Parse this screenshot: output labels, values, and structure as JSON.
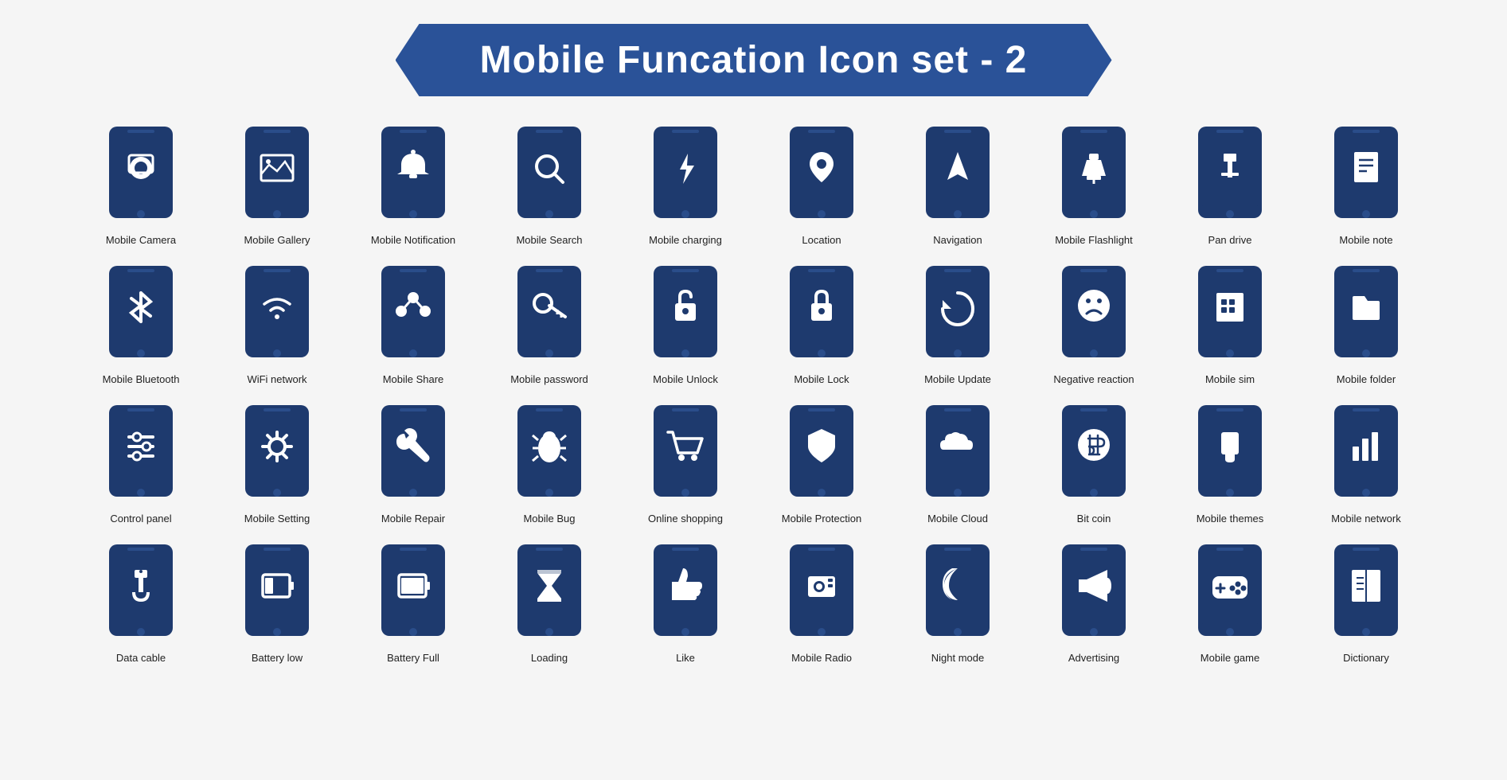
{
  "header": {
    "title": "Mobile Funcation Icon set - 2"
  },
  "icons": [
    {
      "id": "mobile-camera",
      "label": "Mobile Camera",
      "symbol": "camera"
    },
    {
      "id": "mobile-gallery",
      "label": "Mobile Gallery",
      "symbol": "gallery"
    },
    {
      "id": "mobile-notification",
      "label": "Mobile Notification",
      "symbol": "bell"
    },
    {
      "id": "mobile-search",
      "label": "Mobile Search",
      "symbol": "search"
    },
    {
      "id": "mobile-charging",
      "label": "Mobile charging",
      "symbol": "charging"
    },
    {
      "id": "location",
      "label": "Location",
      "symbol": "location"
    },
    {
      "id": "navigation",
      "label": "Navigation",
      "symbol": "navigation"
    },
    {
      "id": "mobile-flashlight",
      "label": "Mobile Flashlight",
      "symbol": "flashlight"
    },
    {
      "id": "pan-drive",
      "label": "Pan drive",
      "symbol": "usb"
    },
    {
      "id": "mobile-note",
      "label": "Mobile note",
      "symbol": "note"
    },
    {
      "id": "mobile-bluetooth",
      "label": "Mobile Bluetooth",
      "symbol": "bluetooth"
    },
    {
      "id": "wifi-network",
      "label": "WiFi network",
      "symbol": "wifi"
    },
    {
      "id": "mobile-share",
      "label": "Mobile Share",
      "symbol": "share"
    },
    {
      "id": "mobile-password",
      "label": "Mobile password",
      "symbol": "key"
    },
    {
      "id": "mobile-unlock",
      "label": "Mobile Unlock",
      "symbol": "unlock"
    },
    {
      "id": "mobile-lock",
      "label": "Mobile Lock",
      "symbol": "lock"
    },
    {
      "id": "mobile-update",
      "label": "Mobile Update",
      "symbol": "update"
    },
    {
      "id": "negative-reaction",
      "label": "Negative reaction",
      "symbol": "sad"
    },
    {
      "id": "mobile-sim",
      "label": "Mobile sim",
      "symbol": "sim"
    },
    {
      "id": "mobile-folder",
      "label": "Mobile folder",
      "symbol": "folder"
    },
    {
      "id": "control-panel",
      "label": "Control panel",
      "symbol": "sliders"
    },
    {
      "id": "mobile-setting",
      "label": "Mobile Setting",
      "symbol": "gear"
    },
    {
      "id": "mobile-repair",
      "label": "Mobile Repair",
      "symbol": "wrench"
    },
    {
      "id": "mobile-bug",
      "label": "Mobile Bug",
      "symbol": "bug"
    },
    {
      "id": "online-shopping",
      "label": "Online shopping",
      "symbol": "cart"
    },
    {
      "id": "mobile-protection",
      "label": "Mobile Protection",
      "symbol": "shield"
    },
    {
      "id": "mobile-cloud",
      "label": "Mobile Cloud",
      "symbol": "cloud"
    },
    {
      "id": "bit-coin",
      "label": "Bit coin",
      "symbol": "bitcoin"
    },
    {
      "id": "mobile-themes",
      "label": "Mobile themes",
      "symbol": "brush"
    },
    {
      "id": "mobile-network",
      "label": "Mobile network",
      "symbol": "barchart"
    },
    {
      "id": "data-cable",
      "label": "Data cable",
      "symbol": "cable"
    },
    {
      "id": "battery-low",
      "label": "Battery low",
      "symbol": "batterylow"
    },
    {
      "id": "battery-full",
      "label": "Battery Full",
      "symbol": "batteryfull"
    },
    {
      "id": "loading",
      "label": "Loading",
      "symbol": "hourglass"
    },
    {
      "id": "like",
      "label": "Like",
      "symbol": "thumbsup"
    },
    {
      "id": "mobile-radio",
      "label": "Mobile Radio",
      "symbol": "radio"
    },
    {
      "id": "night-mode",
      "label": "Night mode",
      "symbol": "moon"
    },
    {
      "id": "advertising",
      "label": "Advertising",
      "symbol": "megaphone"
    },
    {
      "id": "mobile-game",
      "label": "Mobile game",
      "symbol": "gamepad"
    },
    {
      "id": "dictionary",
      "label": "Dictionary",
      "symbol": "book"
    }
  ]
}
